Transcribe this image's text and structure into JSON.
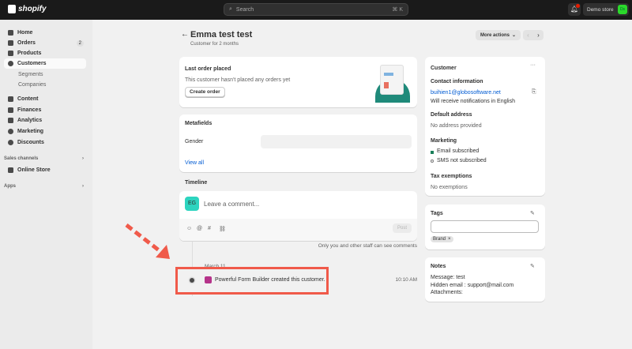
{
  "topbar": {
    "brand": "shopify",
    "search_placeholder": "Search",
    "shortcut": "⌘ K",
    "notification_count": "4",
    "store_name": "Demo store",
    "store_initials": "Ds"
  },
  "sidebar": {
    "items": [
      {
        "label": "Home"
      },
      {
        "label": "Orders",
        "badge": "2"
      },
      {
        "label": "Products"
      },
      {
        "label": "Customers",
        "active": true
      },
      {
        "label": "Segments"
      },
      {
        "label": "Companies"
      },
      {
        "label": "Content"
      },
      {
        "label": "Finances"
      },
      {
        "label": "Analytics"
      },
      {
        "label": "Marketing"
      },
      {
        "label": "Discounts"
      }
    ],
    "sales_channels": "Sales channels",
    "online_store": "Online Store",
    "apps": "Apps"
  },
  "header": {
    "title": "Emma test test",
    "subtitle": "Customer for 2 months",
    "more_actions": "More actions"
  },
  "last_order": {
    "title": "Last order placed",
    "text": "This customer hasn't placed any orders yet",
    "button": "Create order"
  },
  "metafields": {
    "title": "Metafields",
    "field": "Gender",
    "value": "",
    "view_all": "View all"
  },
  "timeline": {
    "title": "Timeline",
    "avatar": "EG",
    "placeholder": "Leave a comment...",
    "post": "Post",
    "note": "Only you and other staff can see comments",
    "date": "March 11",
    "event": "Powerful Form Builder created this customer.",
    "time": "10:10 AM"
  },
  "customer": {
    "title": "Customer",
    "contact_title": "Contact information",
    "email": "buihien1@globosoftware.net",
    "language": "Will receive notifications in English",
    "address_title": "Default address",
    "address": "No address provided",
    "marketing_title": "Marketing",
    "email_status": "Email subscribed",
    "sms_status": "SMS not subscribed",
    "tax_title": "Tax exemptions",
    "tax": "No exemptions"
  },
  "tags": {
    "title": "Tags",
    "input": "",
    "items": [
      "Brand"
    ]
  },
  "notes": {
    "title": "Notes",
    "lines": [
      "Message: test",
      "Hidden email : support@mail.com",
      "Attachments:"
    ]
  },
  "colors": {
    "annotation": "#f05a4a",
    "subscribed": "#1a7f5a",
    "avatar": "#2dd4bf"
  }
}
